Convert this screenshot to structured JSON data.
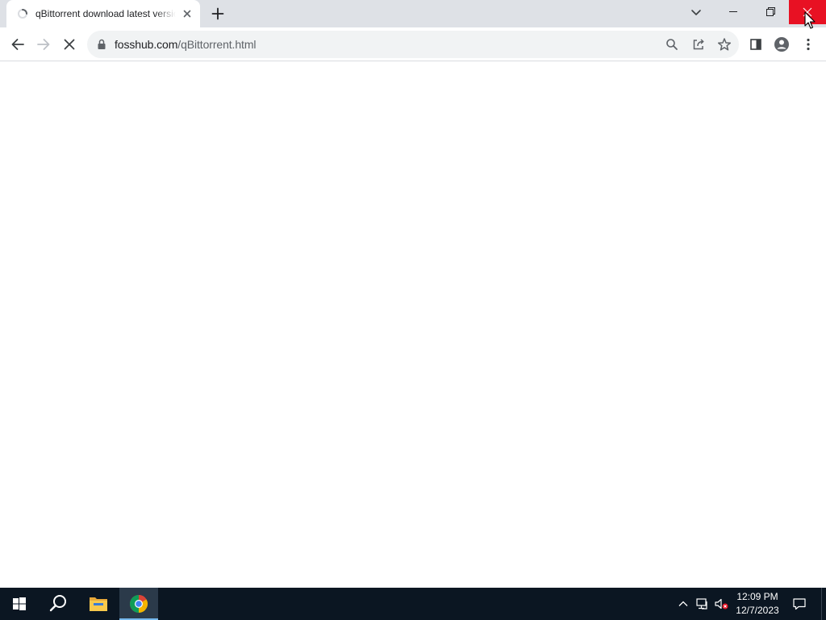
{
  "browser": {
    "tab": {
      "title": "qBittorrent download latest version",
      "favicon": "loading-spinner-icon",
      "close_icon": "close-icon"
    },
    "new_tab_icon": "plus-icon",
    "tab_search_icon": "chevron-down-icon",
    "window_controls": [
      "minimize-icon",
      "restore-icon",
      "close-icon"
    ],
    "toolbar": {
      "back_icon": "arrow-left-icon",
      "forward_icon": "arrow-right-icon",
      "stop_icon": "close-icon",
      "url_host": "fosshub.com",
      "url_path": "/qBittorrent.html",
      "lock_icon": "lock-icon",
      "omnibox_icons": [
        "search-icon",
        "share-icon",
        "star-icon"
      ],
      "side_panel_icon": "side-panel-icon",
      "profile_icon": "profile-icon",
      "menu_icon": "kebab-menu-icon"
    },
    "accent_close_hover": "#e81123"
  },
  "taskbar": {
    "items": [
      "windows-start-icon",
      "search-icon",
      "file-explorer-icon",
      "chrome-icon"
    ],
    "active_item": "chrome-icon",
    "tray_icons": [
      "chevron-up-icon",
      "network-icon",
      "volume-muted-icon"
    ],
    "clock": {
      "time": "12:09 PM",
      "date": "12/7/2023"
    },
    "notification_icon": "notification-icon"
  }
}
